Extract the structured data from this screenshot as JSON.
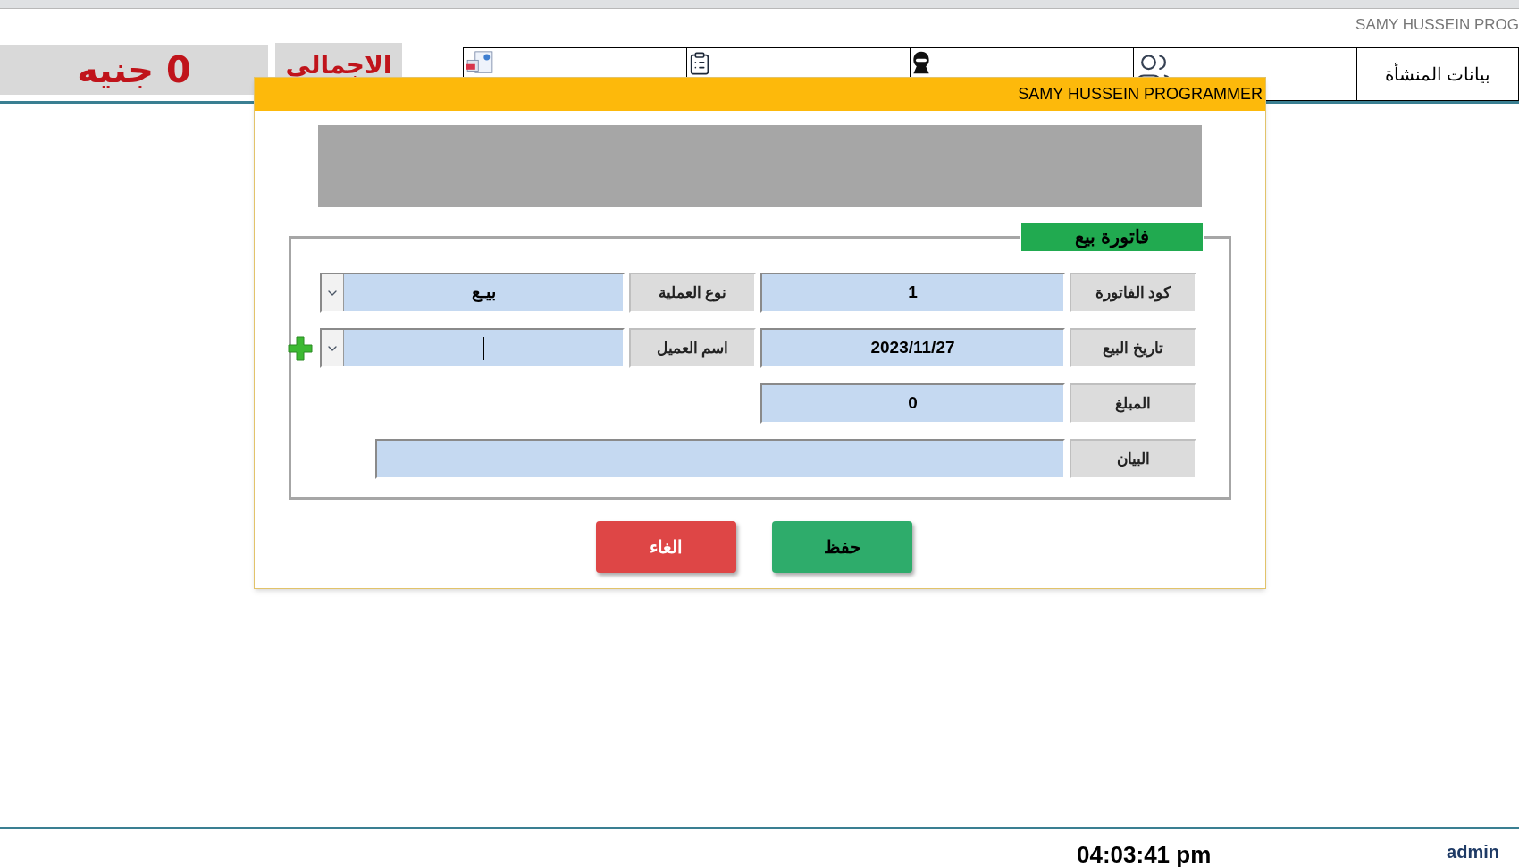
{
  "header": {
    "brand": "SAMY HUSSEIN PROG"
  },
  "total": {
    "label": "الاجمالى",
    "value": "0 جنيه"
  },
  "tabs": [
    {
      "label": "بيانات المنشأة",
      "selected": false
    },
    {
      "selected": false
    },
    {
      "selected": false
    },
    {
      "selected": false
    },
    {
      "selected": false
    }
  ],
  "dialog": {
    "title": "SAMY HUSSEIN PROGRAMMER",
    "form": {
      "title": "فاتورة بيع",
      "rows": [
        {
          "fields": [
            {
              "label": "كود الفاتورة",
              "kind": "text",
              "value": "1"
            },
            {
              "label": "نوع العملية",
              "kind": "combo",
              "value": "بيـع",
              "add_button": false
            }
          ]
        },
        {
          "fields": [
            {
              "label": "تاريخ البيع",
              "kind": "text",
              "value": "2023/11/27"
            },
            {
              "label": "اسم العميل",
              "kind": "combo",
              "focused": true,
              "add_button": true
            }
          ]
        },
        {
          "fields": [
            {
              "label": "المبلغ",
              "kind": "text",
              "value": "0"
            }
          ]
        },
        {
          "fields": [
            {
              "label": "البيان",
              "kind": "wide"
            }
          ]
        }
      ]
    },
    "buttons": [
      {
        "label": "حفظ",
        "kind": "save"
      },
      {
        "label": "الغاء",
        "kind": "cancel"
      }
    ]
  },
  "status_bar": {
    "time": "04:03:41 pm",
    "user": "admin"
  }
}
